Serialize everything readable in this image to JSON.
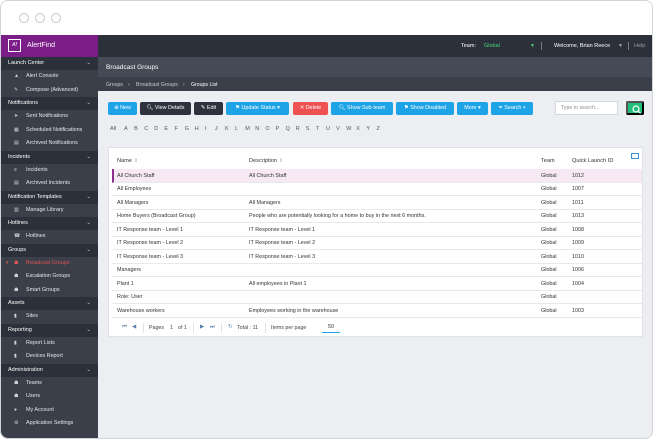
{
  "header": {
    "app_name": "AlertFind",
    "logo_mark": "Af",
    "team_label": "Team:",
    "team_value": "Global",
    "welcome": "Welcome, Brian Reece",
    "help": "Help"
  },
  "sidebar": {
    "sections": [
      {
        "title": "Launch Center",
        "items": [
          {
            "label": "Alert Console",
            "icon": "warning-icon"
          },
          {
            "label": "Compose (Advanced)",
            "icon": "compose-icon"
          }
        ]
      },
      {
        "title": "Notifications",
        "items": [
          {
            "label": "Sent Notifications",
            "icon": "send-icon"
          },
          {
            "label": "Scheduled Notifications",
            "icon": "calendar-icon"
          },
          {
            "label": "Archived Notifications",
            "icon": "archive-icon"
          }
        ]
      },
      {
        "title": "Incidents",
        "items": [
          {
            "label": "Incidents",
            "icon": "list-icon"
          },
          {
            "label": "Archived Incidents",
            "icon": "archive-icon"
          }
        ]
      },
      {
        "title": "Notification Templates",
        "items": [
          {
            "label": "Manage Library",
            "icon": "library-icon"
          }
        ]
      },
      {
        "title": "Hotlines",
        "items": [
          {
            "label": "Hotlines",
            "icon": "phone-icon"
          }
        ]
      },
      {
        "title": "Groups",
        "items": [
          {
            "label": "Broadcast Groups",
            "icon": "group-icon",
            "active": true
          },
          {
            "label": "Escalation Groups",
            "icon": "group-icon"
          },
          {
            "label": "Smart Groups",
            "icon": "group-icon"
          }
        ]
      },
      {
        "title": "Assets",
        "items": [
          {
            "label": "Sites",
            "icon": "chart-icon"
          }
        ]
      },
      {
        "title": "Reporting",
        "items": [
          {
            "label": "Report Lists",
            "icon": "chart-icon"
          },
          {
            "label": "Devices Report",
            "icon": "chart-icon"
          }
        ]
      },
      {
        "title": "Administration",
        "items": [
          {
            "label": "Teams",
            "icon": "group-icon"
          },
          {
            "label": "Users",
            "icon": "group-icon"
          },
          {
            "label": "My Account",
            "icon": "user-icon"
          },
          {
            "label": "Application Settings",
            "icon": "gear-icon"
          }
        ]
      }
    ]
  },
  "page": {
    "title": "Broadcast Groups",
    "breadcrumbs": [
      "Groups",
      "Broadcast Groups",
      "Groups List"
    ]
  },
  "toolbar": {
    "new": "New",
    "view_details": "View Details",
    "edit": "Edit",
    "update_status": "Update Status",
    "delete": "Delete",
    "show_subteam": "Show Sub-team",
    "show_disabled": "Show Disabled",
    "more": "More",
    "search": "Search",
    "search_placeholder": "Type to search..."
  },
  "alphabet": [
    "All",
    "A",
    "B",
    "C",
    "D",
    "E",
    "F",
    "G",
    "H",
    "I",
    "J",
    "K",
    "L",
    "M",
    "N",
    "O",
    "P",
    "Q",
    "R",
    "S",
    "T",
    "U",
    "V",
    "W",
    "X",
    "Y",
    "Z"
  ],
  "table": {
    "columns": {
      "name": "Name",
      "description": "Description",
      "team": "Team",
      "quick_launch": "Quick Launch ID"
    },
    "rows": [
      {
        "name": "All Church Staff",
        "description": "All Church Staff",
        "team": "Global",
        "qlid": "1012",
        "selected": true
      },
      {
        "name": "All Employees",
        "description": "",
        "team": "Global",
        "qlid": "1007"
      },
      {
        "name": "All Managers",
        "description": "All Managers",
        "team": "Global",
        "qlid": "1011"
      },
      {
        "name": "Home Buyers (Broadcast Group)",
        "description": "People who are potentially looking for a home to buy in the next 6 months.",
        "team": "Global",
        "qlid": "1013"
      },
      {
        "name": "IT Response team - Level 1",
        "description": "IT Response team - Level 1",
        "team": "Global",
        "qlid": "1008"
      },
      {
        "name": "IT Response team - Level 2",
        "description": "IT Response team - Level 2",
        "team": "Global",
        "qlid": "1009"
      },
      {
        "name": "IT Response team - Level 3",
        "description": "IT Response team - Level 3",
        "team": "Global",
        "qlid": "1010"
      },
      {
        "name": "Managers",
        "description": "",
        "team": "Global",
        "qlid": "1006"
      },
      {
        "name": "Plant 1",
        "description": "All employees in Plant 1",
        "team": "Global",
        "qlid": "1004"
      },
      {
        "name": "Role: User",
        "description": "",
        "team": "Global",
        "qlid": ""
      },
      {
        "name": "Warehouse workers",
        "description": "Employees working in the warehouse",
        "team": "Global",
        "qlid": "1003"
      }
    ]
  },
  "pager": {
    "pages_label": "Pages",
    "current_page": "1",
    "of_label": "of 1",
    "total": "Total : 11",
    "items_per_page_label": "Items per page",
    "items_per_page": "50"
  },
  "colors": {
    "accent": "#1ea4e6",
    "brand": "#7b1d87",
    "danger": "#ee5151",
    "success": "#1fbf7a"
  }
}
